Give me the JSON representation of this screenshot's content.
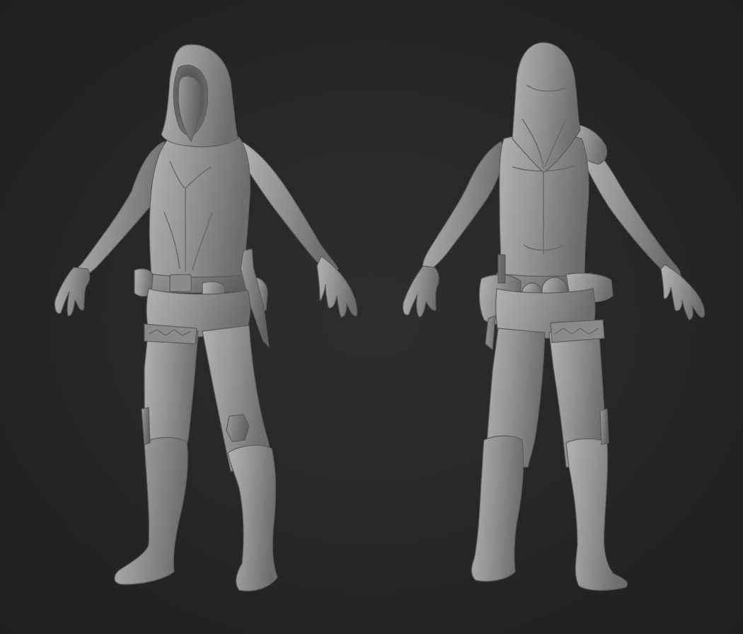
{
  "scene": {
    "background": "#272727",
    "material_color": "#8f8f8f",
    "views": [
      "front",
      "back"
    ]
  }
}
